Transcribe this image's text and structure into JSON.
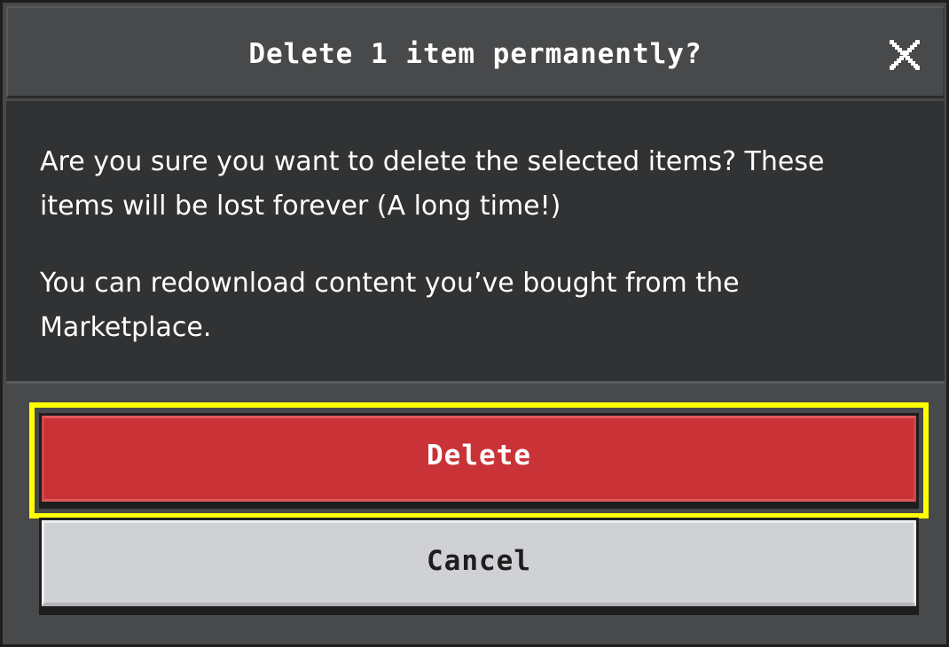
{
  "dialog": {
    "title": "Delete 1 item permanently?",
    "close_icon": "close-x-icon",
    "message_primary": "Are you sure you want to delete the selected items? These items will be lost forever (A long time!)",
    "message_secondary": "You can redownload content you’ve bought from the Marketplace.",
    "delete_label": "Delete",
    "cancel_label": "Cancel"
  },
  "colors": {
    "panel": "#48494a",
    "body": "#313233",
    "delete": "#c93337",
    "cancel": "#d0d1d4",
    "focus": "#ffff00"
  }
}
